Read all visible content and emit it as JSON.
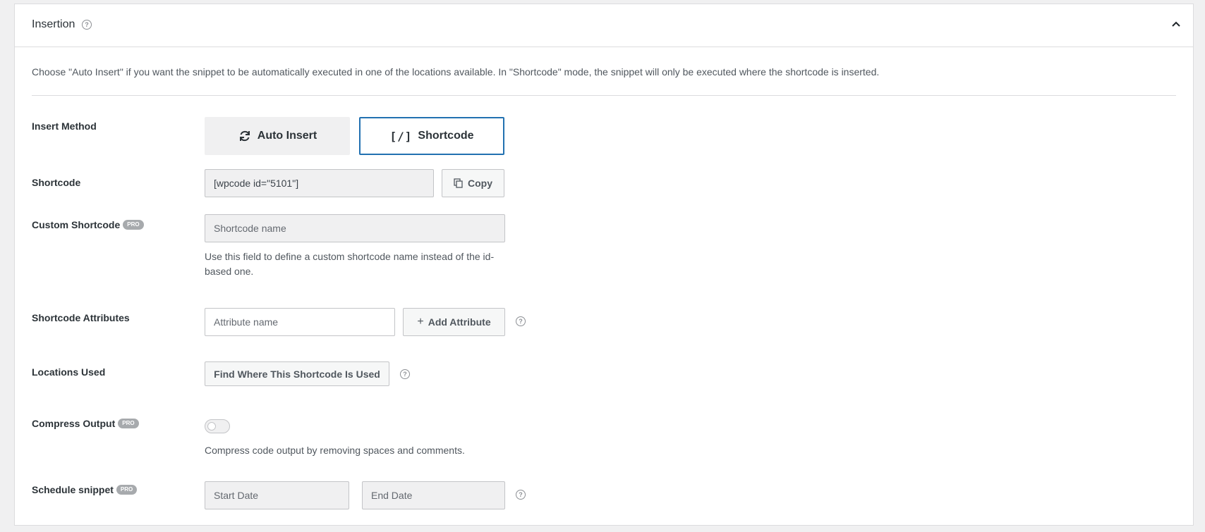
{
  "panel": {
    "title": "Insertion",
    "intro": "Choose \"Auto Insert\" if you want the snippet to be automatically executed in one of the locations available. In \"Shortcode\" mode, the snippet will only be executed where the shortcode is inserted."
  },
  "insert_method": {
    "label": "Insert Method",
    "auto_label": "Auto Insert",
    "shortcode_label": "Shortcode",
    "shortcode_glyph": "[/]",
    "selected": "Shortcode"
  },
  "shortcode": {
    "label": "Shortcode",
    "value": "[wpcode id=\"5101\"]",
    "copy_label": "Copy"
  },
  "custom_shortcode": {
    "label": "Custom Shortcode",
    "badge": "PRO",
    "placeholder": "Shortcode name",
    "help": "Use this field to define a custom shortcode name instead of the id-based one."
  },
  "attributes": {
    "label": "Shortcode Attributes",
    "placeholder": "Attribute name",
    "add_label": "Add Attribute"
  },
  "locations": {
    "label": "Locations Used",
    "button_label": "Find Where This Shortcode Is Used"
  },
  "compress": {
    "label": "Compress Output",
    "badge": "PRO",
    "enabled": false,
    "help": "Compress code output by removing spaces and comments."
  },
  "schedule": {
    "label": "Schedule snippet",
    "badge": "PRO",
    "start_placeholder": "Start Date",
    "end_placeholder": "End Date"
  },
  "colors": {
    "accent": "#2271b1",
    "badge": "#a7aaad"
  }
}
